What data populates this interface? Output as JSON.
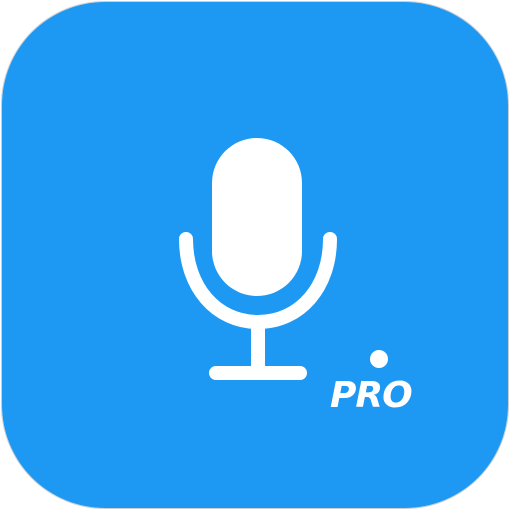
{
  "app_icon": {
    "name": "voice-recorder-pro",
    "colors": {
      "background": "#1D99F4",
      "glyph": "#FFFFFF",
      "border": "#CFCFCF"
    },
    "icons": {
      "main": "microphone-icon"
    },
    "badge": {
      "text": "PRO"
    }
  }
}
